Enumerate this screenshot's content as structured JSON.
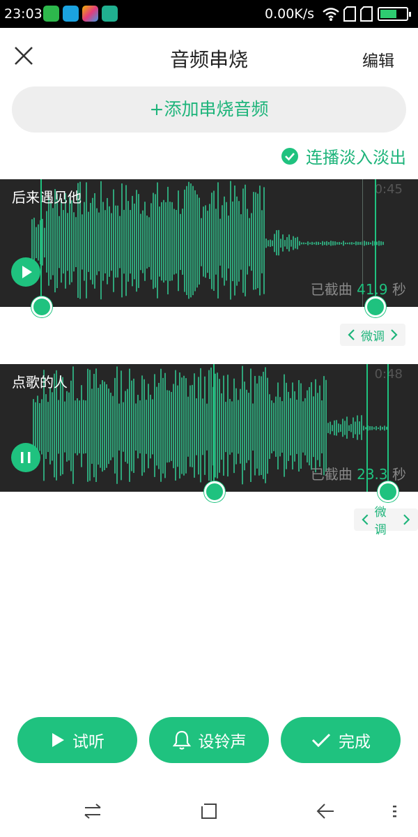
{
  "status_bar": {
    "time": "23:03",
    "speed": "0.00K/s",
    "app_icons": [
      "wechat-app-icon",
      "browser-app-icon",
      "gallery-app-icon",
      "usb-icon"
    ],
    "icons": [
      "wifi-icon",
      "no-sim-icon",
      "no-sim-icon",
      "battery-icon"
    ],
    "battery_level": 0.65
  },
  "header": {
    "title": "音频串烧",
    "edit_label": "编辑",
    "close_icon": "close-icon"
  },
  "add_button": {
    "label": "+添加串烧音频"
  },
  "crossfade": {
    "label": "连播淡入淡出",
    "checked": true
  },
  "tracks": [
    {
      "name": "后来遇见他",
      "duration": "0:45",
      "cut_prefix": "已截曲",
      "cut_seconds": "41.9",
      "cut_suffix": "秒",
      "playing": false,
      "fine_tune_label": "微调"
    },
    {
      "name": "点歌的人",
      "duration": "0:48",
      "cut_prefix": "已截曲",
      "cut_seconds": "23.3",
      "cut_suffix": "秒",
      "playing": true,
      "fine_tune_label": "微调"
    }
  ],
  "actions": {
    "preview_label": "试听",
    "ringtone_label": "设铃声",
    "done_label": "完成"
  },
  "colors": {
    "accent": "#1fc27f",
    "accent_text": "#1db47a",
    "waveform_bg": "#262626",
    "waveform": "#2fa57a"
  },
  "nav_bar": {
    "icons": [
      "switch-icon",
      "home-icon",
      "back-icon",
      "menu-icon"
    ]
  }
}
